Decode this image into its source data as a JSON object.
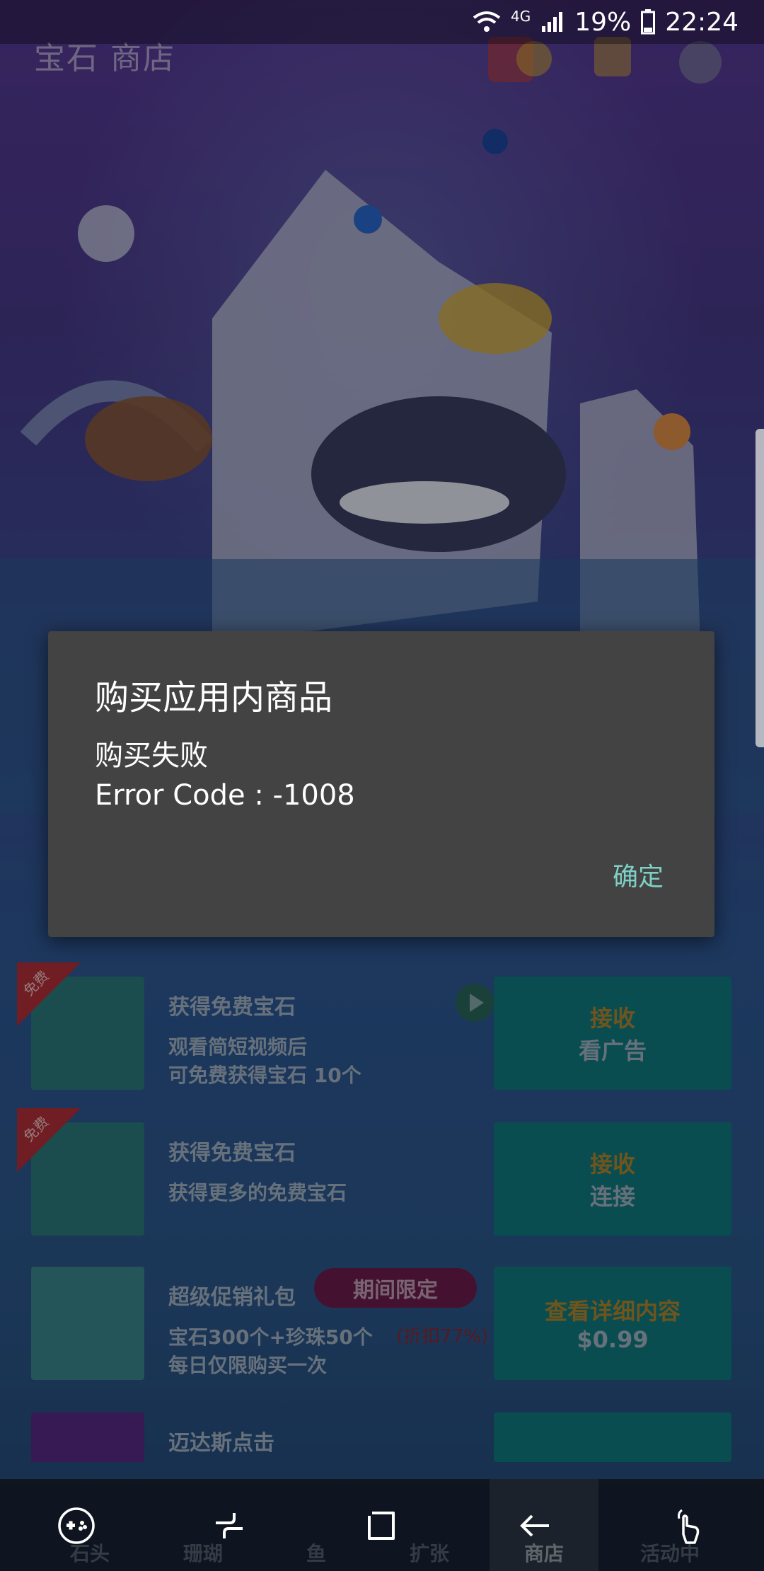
{
  "status_bar": {
    "network": "4G",
    "battery": "19%",
    "time": "22:24"
  },
  "header": {
    "title": "宝石 商店"
  },
  "list": [
    {
      "ribbon": "免费",
      "title": "获得免费宝石",
      "desc": "观看简短视频后\n可免费获得宝石 10个",
      "btn_line1": "接收",
      "btn_line2": "看广告"
    },
    {
      "ribbon": "免费",
      "title": "获得免费宝石",
      "desc": "获得更多的免费宝石",
      "btn_line1": "接收",
      "btn_line2": "连接"
    },
    {
      "title": "超级促销礼包",
      "badge": "期间限定",
      "desc": "宝石300个+珍珠50个\n每日仅限购买一次",
      "discount": "(折扣77%)",
      "btn_line1": "查看详细内容",
      "btn_line2": "$0.99"
    },
    {
      "title": "迈达斯点击"
    }
  ],
  "tabs": [
    {
      "label": "石头"
    },
    {
      "label": "珊瑚"
    },
    {
      "label": "鱼"
    },
    {
      "label": "扩张"
    },
    {
      "label": "商店",
      "active": true
    },
    {
      "label": "活动中"
    }
  ],
  "dialog": {
    "title": "购买应用内商品",
    "message_line1": "购买失败",
    "message_line2": "Error Code : -1008",
    "ok_label": "确定"
  },
  "icons": {
    "gamepad": "gamepad-icon",
    "recent": "recent-apps-icon",
    "home": "home-icon",
    "back": "back-icon",
    "touch": "touch-icon"
  },
  "colors": {
    "dialog_bg": "#434343",
    "dialog_button": "#7ecfc4",
    "shop_button": "#117c82"
  }
}
